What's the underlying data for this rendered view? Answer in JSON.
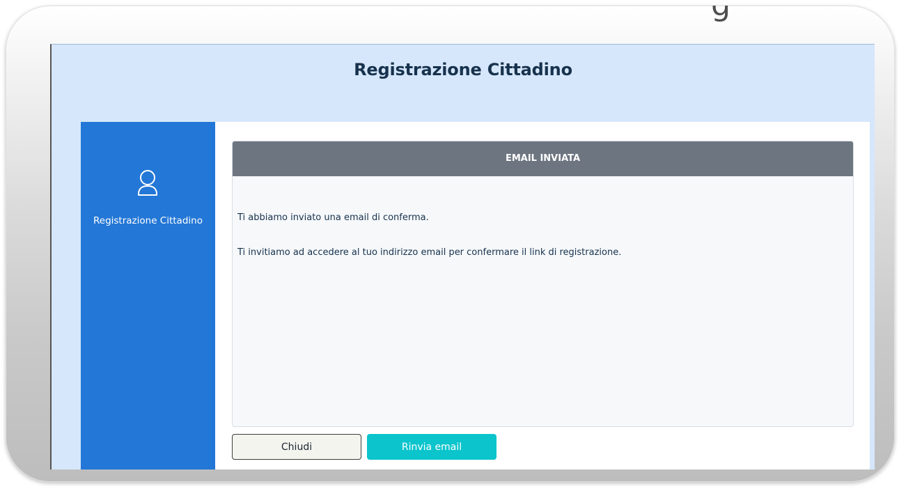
{
  "page": {
    "title": "Registrazione Cittadino"
  },
  "sidebar": {
    "icon": "user-icon",
    "label": "Registrazione Cittadino"
  },
  "card": {
    "header": "EMAIL INVIATA",
    "line_1": "Ti abbiamo inviato una email di conferma.",
    "line_2": "Ti invitiamo ad accedere al tuo indirizzo email per confermare il link di registrazione."
  },
  "actions": {
    "close_label": "Chiudi",
    "resend_label": "Rinvia email"
  },
  "colors": {
    "sidebar": "#2377d6",
    "header_bg": "#d6e7fb",
    "card_header": "#6d7580",
    "accent": "#0bc4cc"
  }
}
